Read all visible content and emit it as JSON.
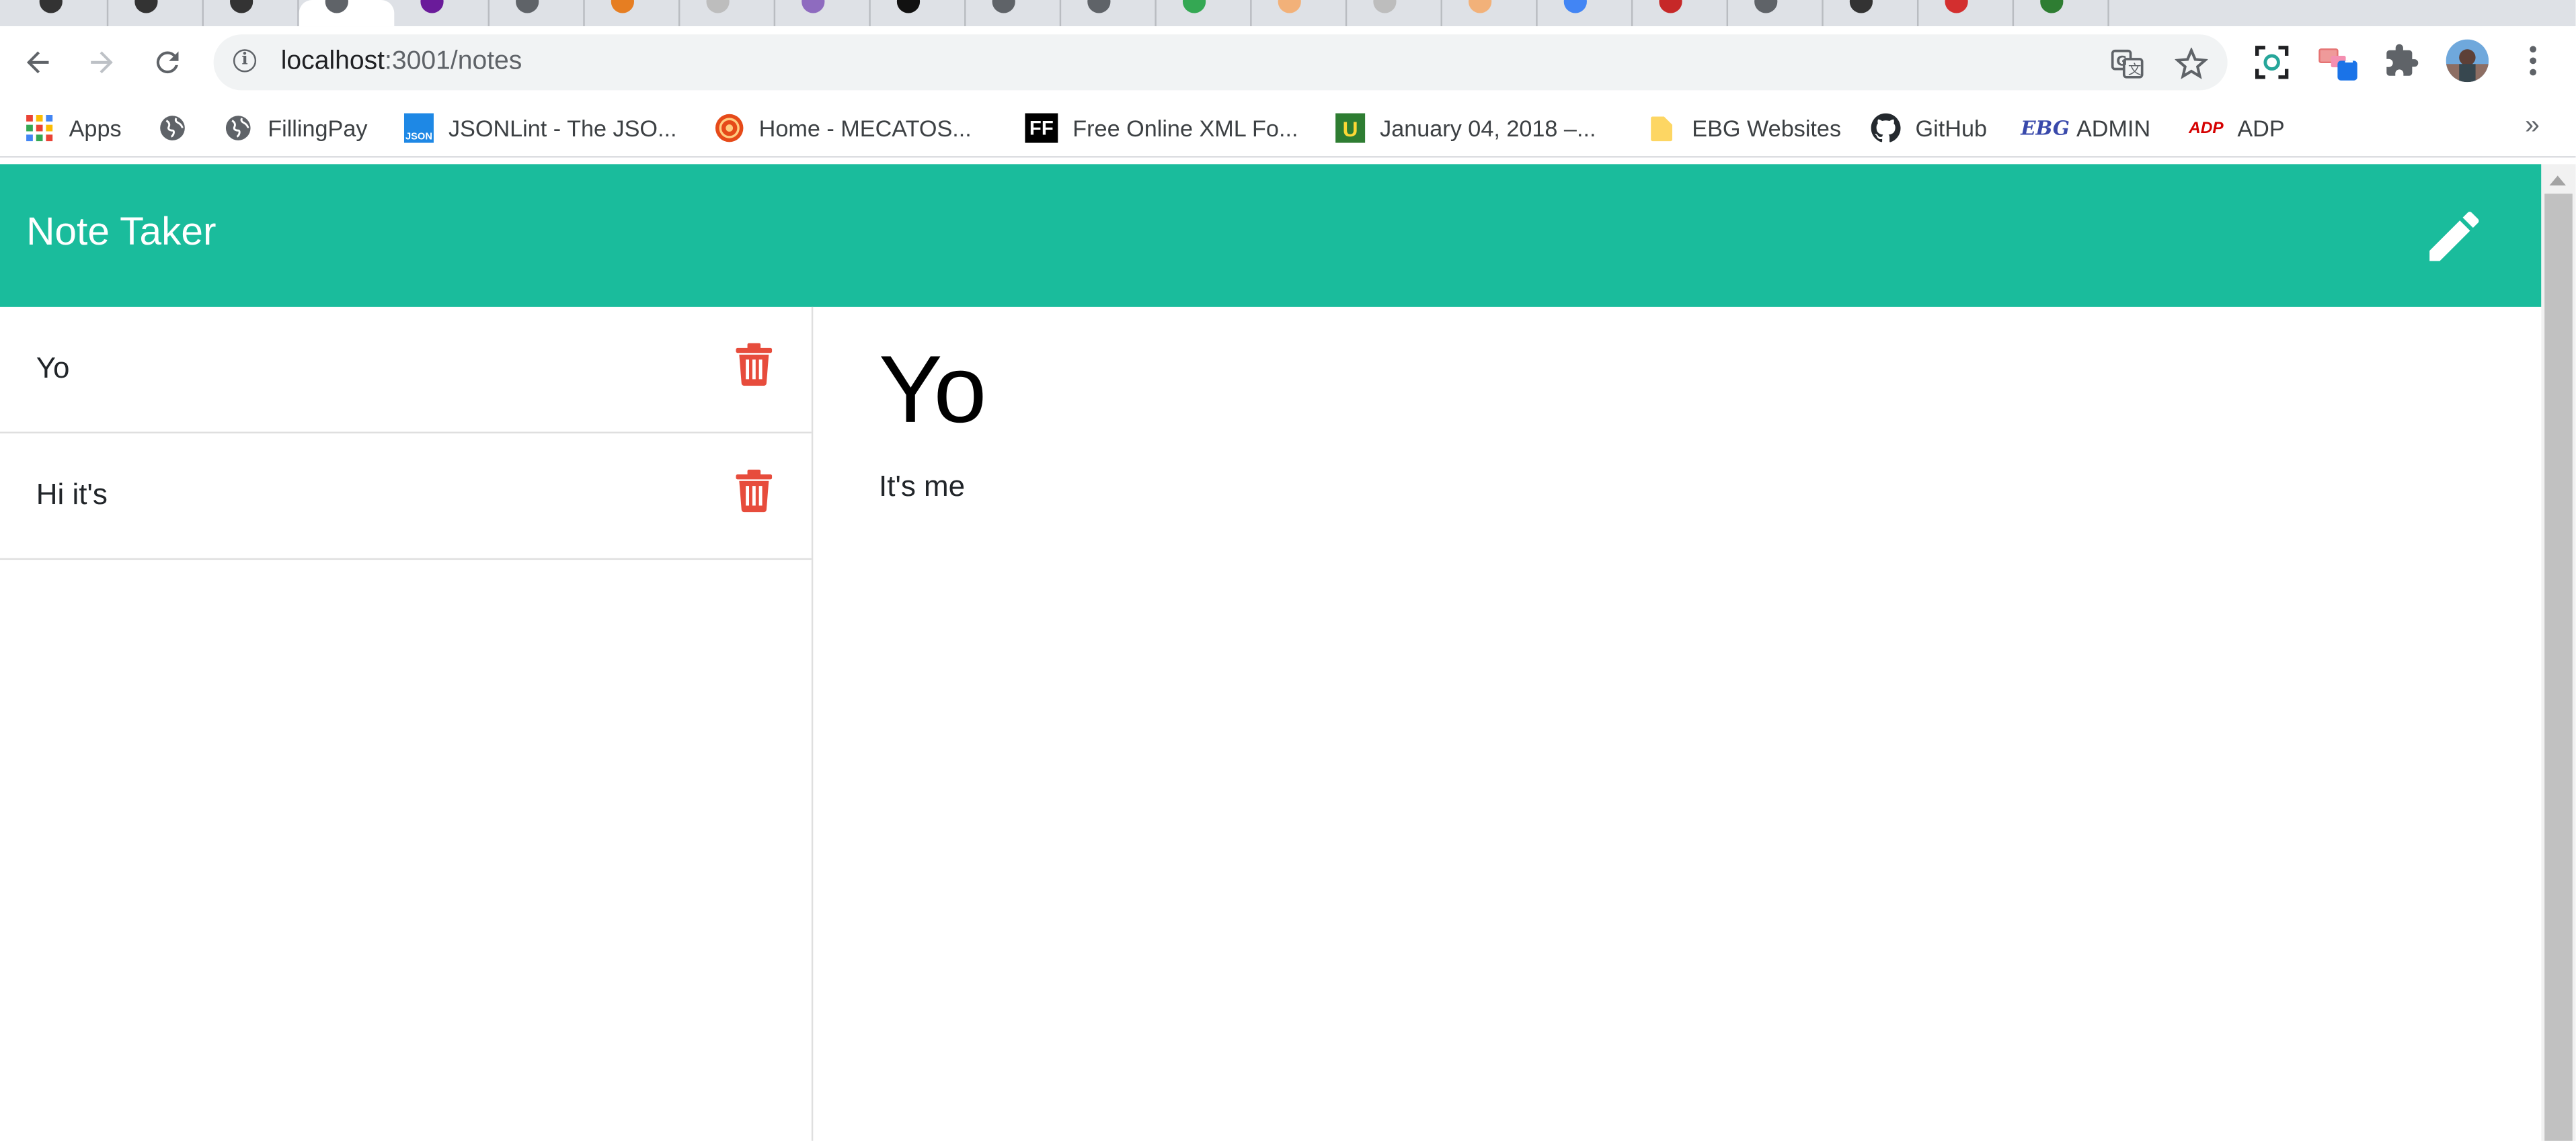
{
  "browser": {
    "url_host": "localhost",
    "url_path": ":3001/notes",
    "tab_favicon_colors": [
      "#333333",
      "#333333",
      "#333333",
      "#5f6368",
      "#6a1b9a",
      "#5f6368",
      "#e67e22",
      "#bdbdbd",
      "#8e6bbf",
      "#111111",
      "#5f6368",
      "#5f6368",
      "#34a853",
      "#f2b179",
      "#bdbdbd",
      "#f2b179",
      "#4285f4",
      "#c62828",
      "#5f6368",
      "#333333",
      "#d32f2f",
      "#2e7d32"
    ],
    "extension_badge": "1"
  },
  "bookmarks": [
    {
      "label": "Apps",
      "icon": "apps-grid-icon",
      "color": "#4285f4"
    },
    {
      "label": "",
      "icon": "globe-icon",
      "color": "#5f6368"
    },
    {
      "label": "FillingPay",
      "icon": "globe-icon",
      "color": "#5f6368"
    },
    {
      "label": "JSONLint - The JSO...",
      "icon": "jsonlint-icon",
      "color": "#1e88e5"
    },
    {
      "label": "Home - MECATOS...",
      "icon": "mecatos-icon",
      "color": "#e64a19"
    },
    {
      "label": "Free Online XML Fo...",
      "icon": "ff-icon",
      "color": "#000000"
    },
    {
      "label": "January 04, 2018 –...",
      "icon": "u-icon",
      "color": "#2e7d32"
    },
    {
      "label": "EBG Websites",
      "icon": "folder-icon",
      "color": "#fdd663"
    },
    {
      "label": "GitHub",
      "icon": "github-icon",
      "color": "#24292e"
    },
    {
      "label": "ADMIN",
      "icon": "ebg-icon",
      "color": "#3949ab"
    },
    {
      "label": "ADP",
      "icon": "adp-icon",
      "color": "#d50000"
    }
  ],
  "app": {
    "brand": "Note Taker",
    "accent_color": "#1abc9c",
    "delete_color": "#e74c3c"
  },
  "notes": [
    {
      "title": "Yo"
    },
    {
      "title": "Hi it's"
    }
  ],
  "active_note": {
    "title": "Yo",
    "text": "It's me"
  }
}
